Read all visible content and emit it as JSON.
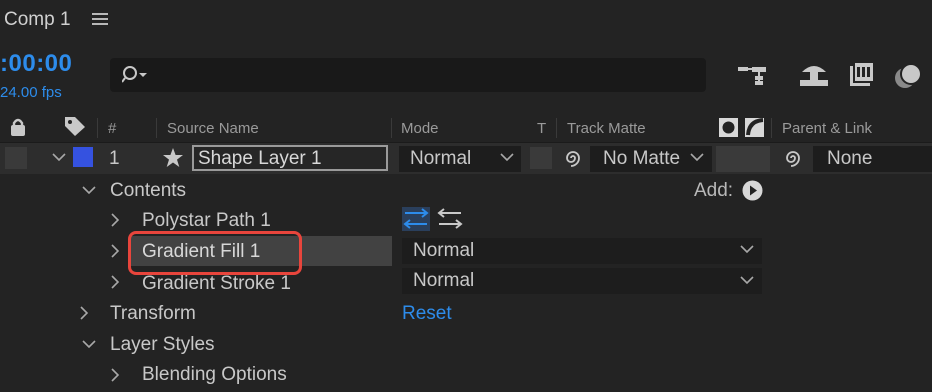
{
  "tab": {
    "title": "Comp 1",
    "menu_icon": "hamburger-menu-icon"
  },
  "header": {
    "timecode": ":00:00",
    "fps": "24.00 fps",
    "search_icon": "search-icon",
    "tool_icons": [
      "composition-flowchart-icon",
      "solo-draft-3d-icon",
      "frame-blending-icon",
      "motion-blur-icon"
    ]
  },
  "columns": {
    "number": "#",
    "source_name": "Source Name",
    "mode": "Mode",
    "t": "T",
    "track_matte": "Track Matte",
    "parent_link": "Parent & Link"
  },
  "layer": {
    "number": "1",
    "name": "Shape Layer 1",
    "mode": "Normal",
    "track_matte": "No Matte",
    "parent": "None",
    "label_color": "#3552e0"
  },
  "tree": {
    "contents": "Contents",
    "add_label": "Add:",
    "polystar": "Polystar Path 1",
    "gradient_fill": "Gradient Fill 1",
    "gradient_fill_mode": "Normal",
    "gradient_stroke": "Gradient Stroke 1",
    "gradient_stroke_mode": "Normal",
    "transform": "Transform",
    "transform_reset": "Reset",
    "layer_styles": "Layer Styles",
    "blending_options": "Blending Options"
  },
  "colors": {
    "accent": "#2d8ceb",
    "highlight": "#e8453c",
    "background": "#232323"
  }
}
